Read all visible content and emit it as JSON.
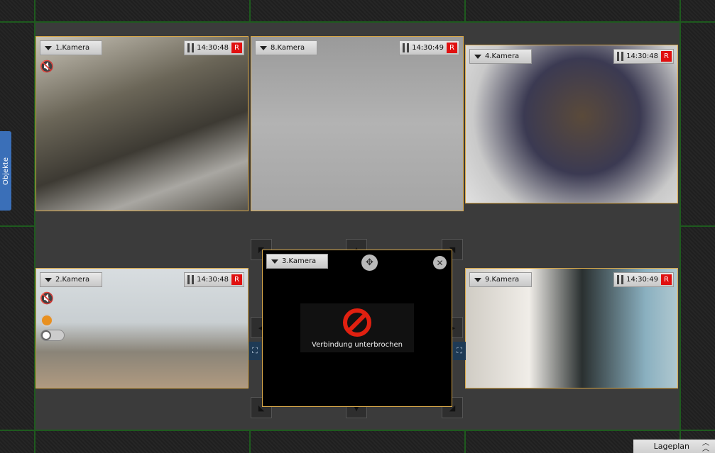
{
  "cameras": [
    {
      "name": "1.Kamera",
      "time": "14:30:48",
      "rec": "R"
    },
    {
      "name": "8.Kamera",
      "time": "14:30:49",
      "rec": "R"
    },
    {
      "name": "4.Kamera",
      "time": "14:30:48",
      "rec": "R"
    },
    {
      "name": "2.Kamera",
      "time": "14:30:48",
      "rec": "R"
    },
    {
      "name": "9.Kamera",
      "time": "14:30:49",
      "rec": "R"
    },
    {
      "name": "3.Kamera",
      "error": "Verbindung unterbrochen"
    }
  ],
  "side_tab": "Objekte",
  "bottom_tab": "Lageplan",
  "colors": {
    "frame": "#d8a84a",
    "grid": "#1e5a1e",
    "rec": "#e01010",
    "tab": "#3a6fb8"
  }
}
